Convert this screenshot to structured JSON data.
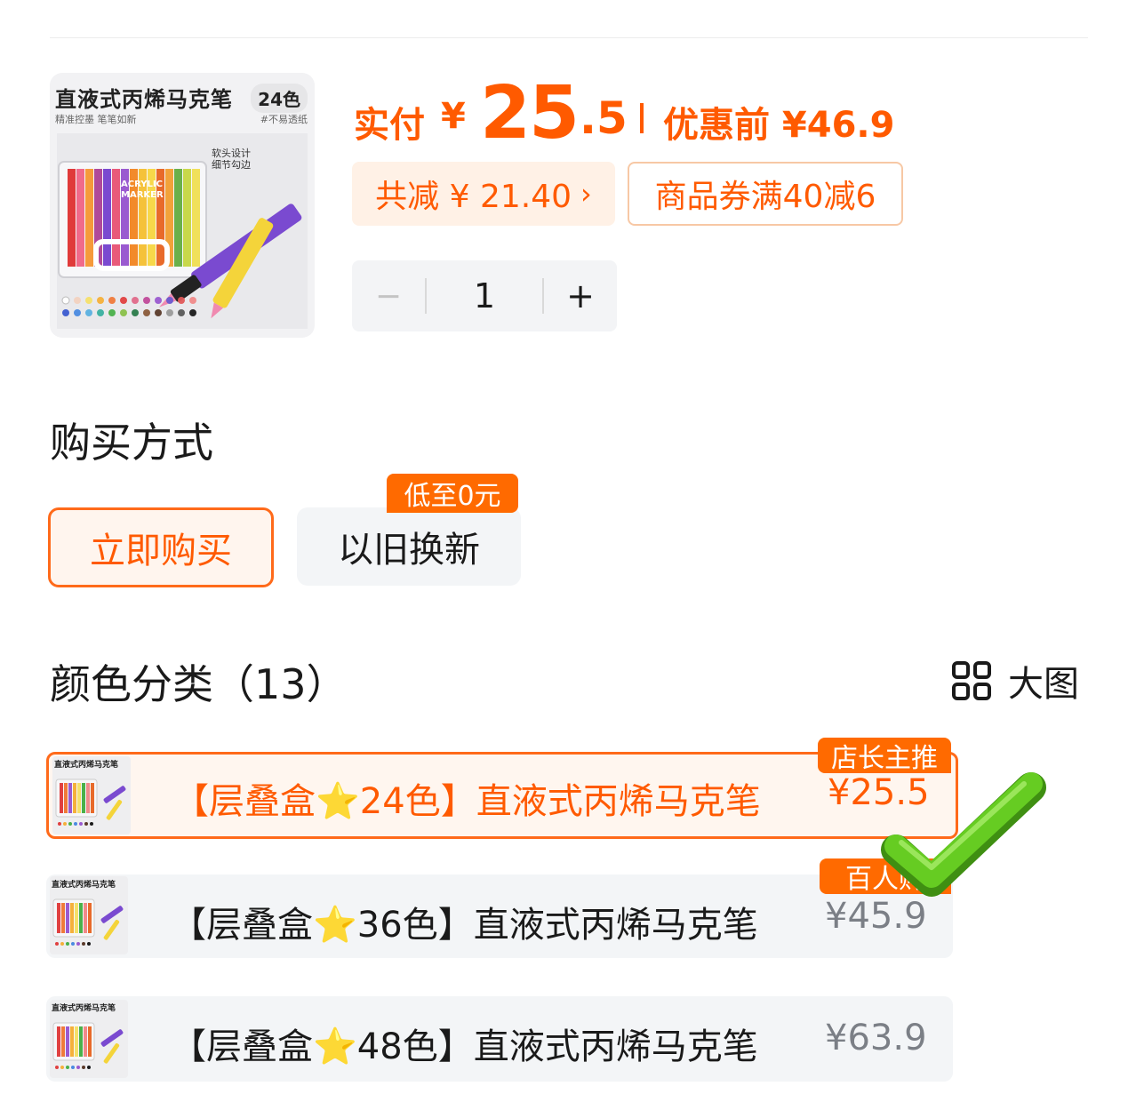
{
  "product": {
    "image": {
      "title": "直液式丙烯马克笔",
      "badge": "24色",
      "subtitle": "精准控墨 笔笔如新",
      "subtitle_right": "#不易透纸",
      "note_line1": "软头设计",
      "note_line2": "细节勾边",
      "box_text1": "ACRYLIC",
      "box_text2": "MARKER"
    },
    "pay_label": "实付",
    "currency": "¥",
    "price_int": "25",
    "price_dec": ".5",
    "original_price_text": "优惠前 ¥46.9",
    "total_discount": "共减 ¥ 21.40",
    "total_discount_arrow": "›",
    "coupon": "商品券满40减6"
  },
  "quantity": {
    "minus_label": "−",
    "value": "1",
    "plus_label": "+"
  },
  "purchase_method": {
    "title": "购买方式",
    "buy_now": "立即购买",
    "trade_in": "以旧换新",
    "trade_in_badge": "低至0元"
  },
  "colors": {
    "title": "颜色分类（13）",
    "big_view_label": "大图",
    "items": [
      {
        "name": "【层叠盒⭐24色】直液式丙烯马克笔",
        "price": "¥25.5",
        "tag": "店长主推",
        "thumb_title": "直液式丙烯马克笔"
      },
      {
        "name": "【层叠盒⭐36色】直液式丙烯马克笔",
        "price": "¥45.9",
        "tag": "百人购",
        "thumb_title": "直液式丙烯马克笔"
      },
      {
        "name": "【层叠盒⭐48色】直液式丙烯马克笔",
        "price": "¥63.9",
        "thumb_title": "直液式丙烯马克笔"
      }
    ]
  },
  "theme": {
    "accent": "#ff5a00",
    "check_green": "#5cc41a"
  }
}
